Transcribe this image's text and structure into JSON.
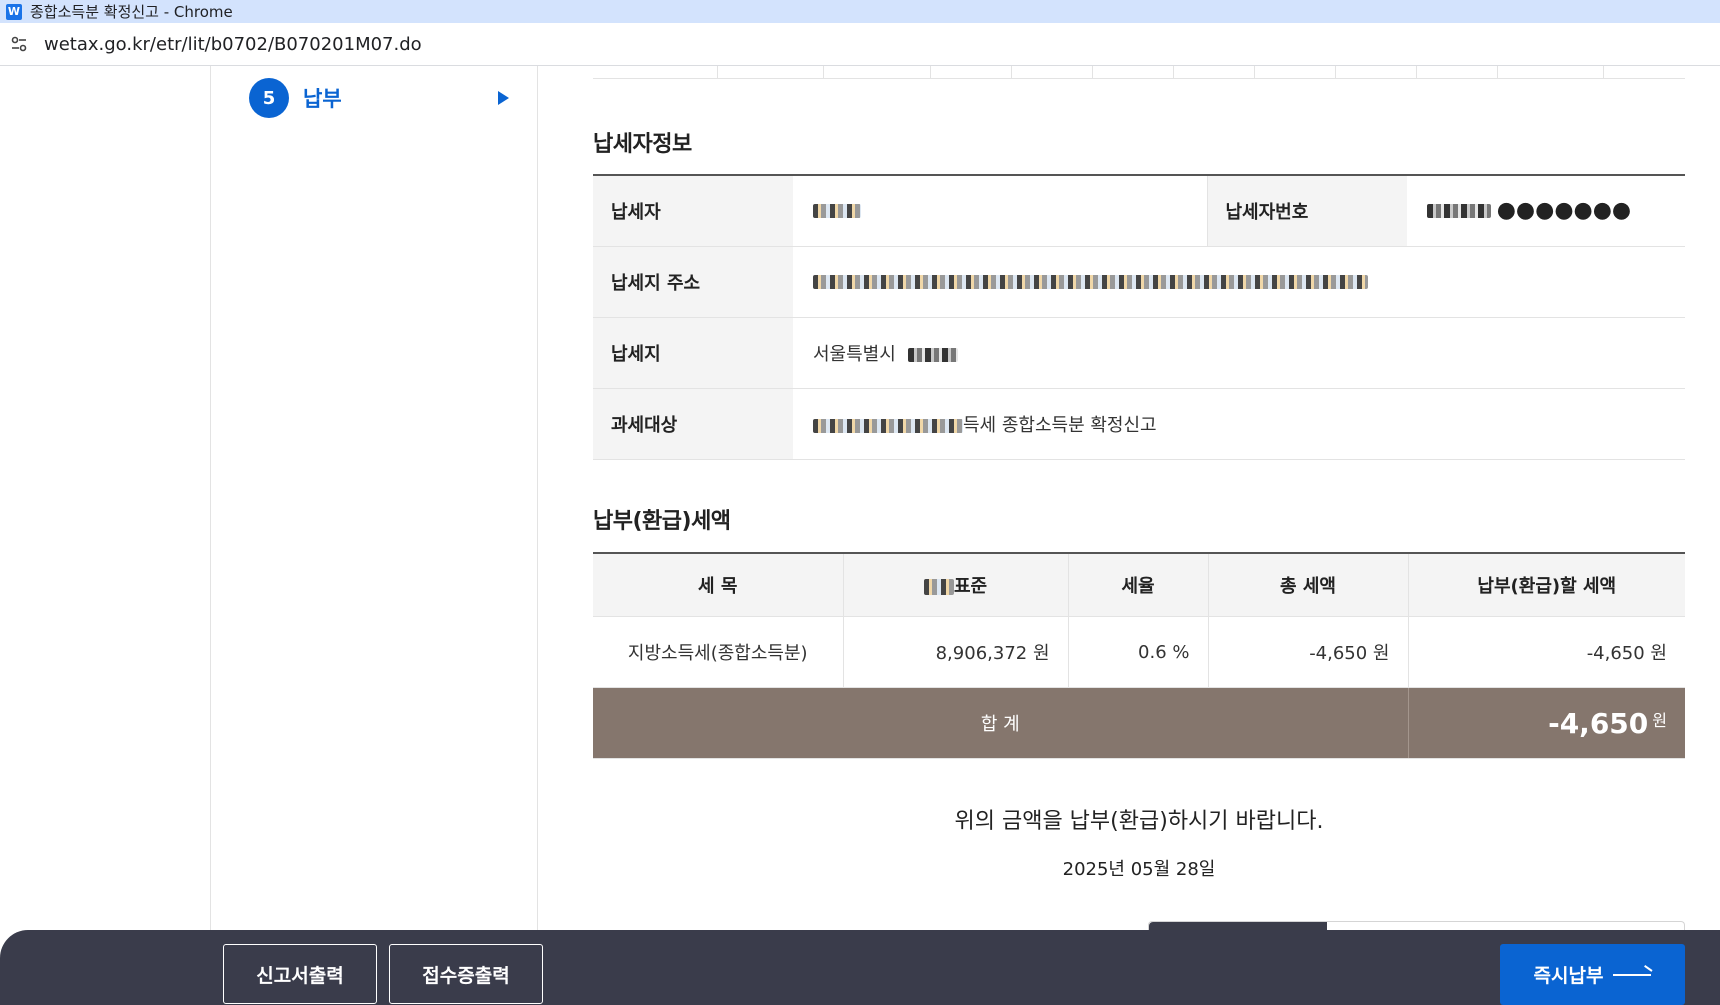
{
  "window": {
    "title": "종합소득분 확정신고 - Chrome",
    "app_logo": "W"
  },
  "address": {
    "url": "wetax.go.kr/etr/lit/b0702/B070201M07.do"
  },
  "steps": {
    "current": {
      "number": "5",
      "label": "납부"
    }
  },
  "taxpayer": {
    "section_title": "납세자정보",
    "rows": [
      {
        "label": "납세자",
        "value": "",
        "label2": "납세자번호",
        "value2": "●●●●●●●"
      },
      {
        "label": "납세지 주소",
        "value": ""
      },
      {
        "label": "납세지",
        "value": "서울특별시"
      },
      {
        "label": "과세대상",
        "value": "득세 종합소득분 확정신고"
      }
    ]
  },
  "amounts": {
    "section_title": "납부(환급)세액",
    "headers": [
      "세 목",
      "표준",
      "세율",
      "총 세액",
      "납부(환급)할 세액"
    ],
    "rows": [
      {
        "item": "지방소득세(종합소득분)",
        "base": "8,906,372 원",
        "rate": "0.6 %",
        "total": "-4,650 원",
        "payable": "-4,650 원"
      }
    ],
    "total_label": "합 계",
    "total_value": "-4,650",
    "total_unit": "원"
  },
  "notice": "위의 금액을 납부(환급)하시기 바랍니다.",
  "date": "2025년 05월 28일",
  "actions": {
    "print_report": "신고서출력",
    "print_receipt": "접수증출력",
    "pay_now": "즉시납부"
  },
  "colors": {
    "primary": "#0a64d2",
    "total_bg": "#85766d",
    "action_bar": "#3a3c4b"
  }
}
